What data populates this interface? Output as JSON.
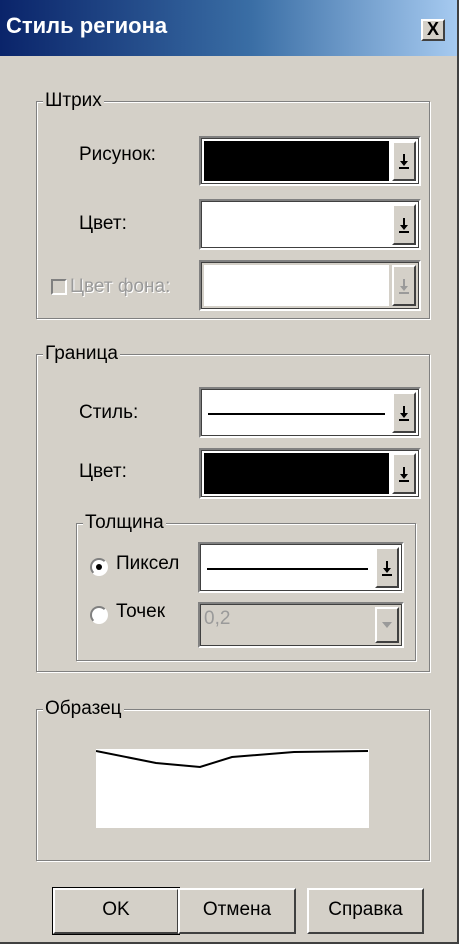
{
  "window": {
    "title": "Стиль региона",
    "close_symbol": "X"
  },
  "fill_group": {
    "legend": "Штрих",
    "pattern_label": "Рисунок:",
    "color_label": "Цвет:",
    "bg_color_label": "Цвет фона:",
    "bg_color_enabled": false,
    "pattern_swatch": "#000000",
    "color_swatch": "#ffffff"
  },
  "border_group": {
    "legend": "Граница",
    "style_label": "Стиль:",
    "color_label": "Цвет:",
    "color_swatch": "#000000",
    "thickness": {
      "legend": "Толщина",
      "pixel_label": "Пиксел",
      "points_label": "Точек",
      "selected": "pixel",
      "points_value": "0,2"
    }
  },
  "sample_group": {
    "legend": "Образец"
  },
  "buttons": {
    "ok": "OK",
    "cancel": "Отмена",
    "help": "Справка"
  }
}
